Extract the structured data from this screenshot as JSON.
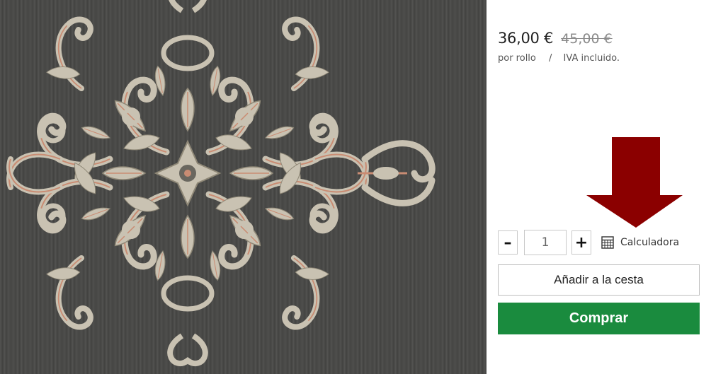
{
  "product": {
    "image_alt": "Papel pintado damasco gris",
    "price_current": "36,00 €",
    "price_old": "45,00 €",
    "unit": "por rollo",
    "separator": "/",
    "vat_note": "IVA incluido."
  },
  "quantity": {
    "decrement_label": "–",
    "value": "1",
    "increment_label": "+",
    "calculator_icon": "calculator-icon",
    "calculator_label": "Calculadora"
  },
  "actions": {
    "add_to_cart_label": "Añadir a la cesta",
    "buy_label": "Comprar"
  },
  "colors": {
    "buy_button_bg": "#1a8b3e",
    "buy_button_text": "#ffffff",
    "arrow": "#8b0000",
    "wallpaper_bg": "#4a4a48",
    "pattern_light": "#c9c2b2",
    "pattern_accent": "#c98c73"
  }
}
